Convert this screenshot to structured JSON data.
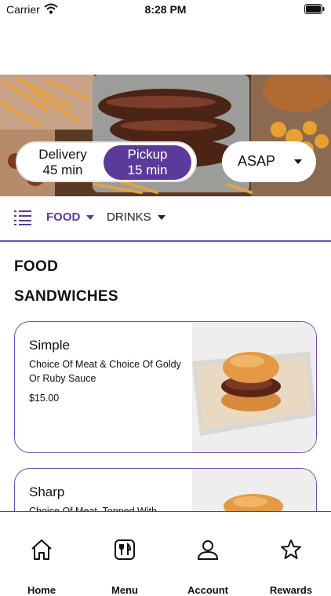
{
  "status_bar": {
    "carrier": "Carrier",
    "time": "8:28 PM"
  },
  "order_mode": {
    "delivery_label": "Delivery",
    "delivery_time": "45 min",
    "pickup_label": "Pickup",
    "pickup_time": "15 min",
    "selected": "pickup",
    "schedule": "ASAP"
  },
  "categories": {
    "food": "FOOD",
    "drinks": "DRINKS",
    "active": "food"
  },
  "menu": {
    "section_title": "FOOD",
    "subsection_title": "SANDWICHES",
    "items": [
      {
        "name": "Simple",
        "description": "Choice Of Meat & Choice Of Goldy Or Ruby Sauce",
        "price": "$15.00"
      },
      {
        "name": "Sharp",
        "description": "Choice Of Meat, Topped With"
      }
    ]
  },
  "tabs": [
    {
      "label": "Home",
      "icon": "home-icon"
    },
    {
      "label": "Menu",
      "icon": "menu-icon"
    },
    {
      "label": "Account",
      "icon": "account-icon"
    },
    {
      "label": "Rewards",
      "icon": "star-icon"
    }
  ],
  "colors": {
    "brand": "#5b3a9b",
    "border": "#6b4fb0"
  }
}
